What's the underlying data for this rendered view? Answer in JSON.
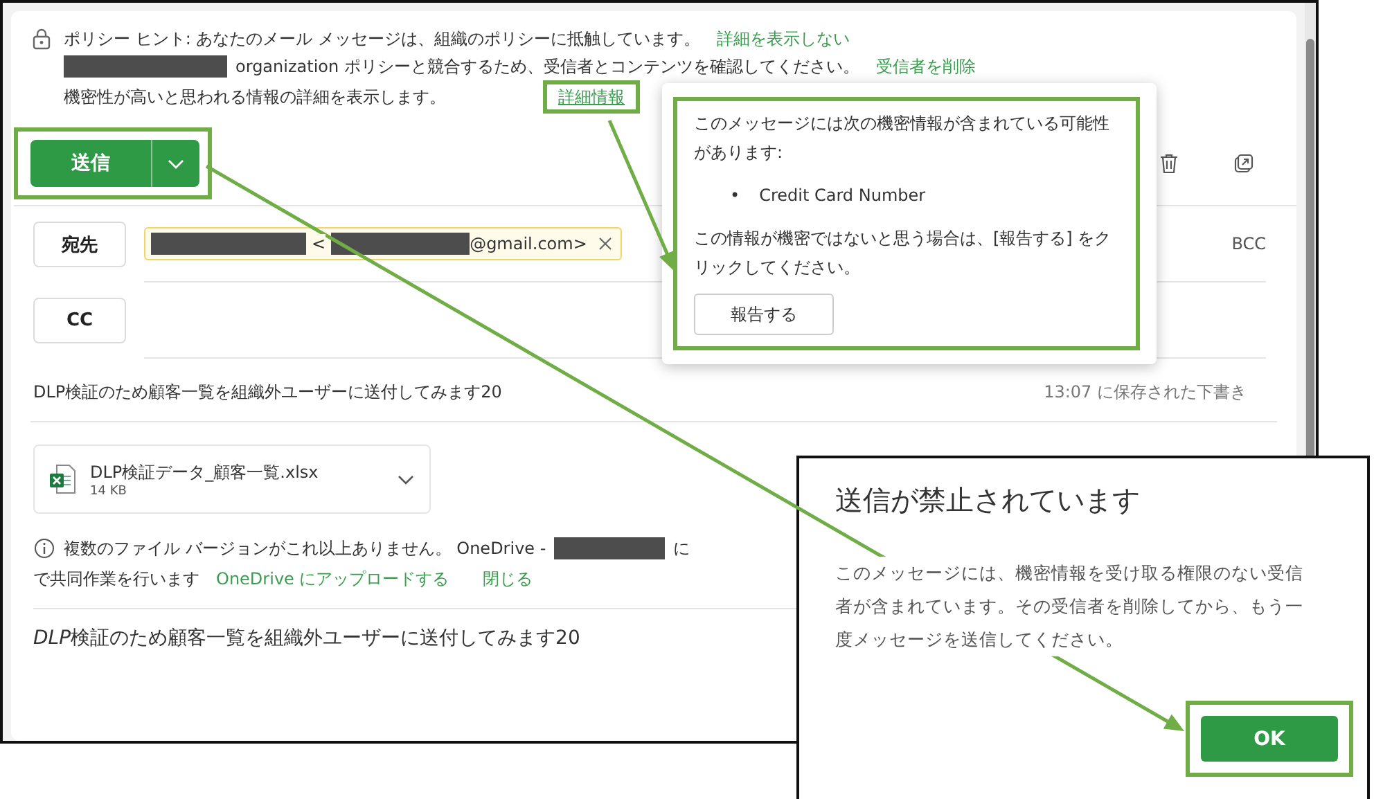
{
  "policy_hint": {
    "line_1": "ポリシー ヒント: あなたのメール メッセージは、組織のポリシーに抵触しています。",
    "hide_details_link": "詳細を表示しない",
    "line_2": "organization ポリシーと競合するため、受信者とコンテンツを確認してください。",
    "remove_recipients_link": "受信者を削除",
    "line_3": "機密性が高いと思われる情報の詳細を表示します。",
    "more_info_link": "詳細情報"
  },
  "toolbar": {
    "send_button": "送信"
  },
  "recipients": {
    "to_button": "宛先",
    "to_chip": {
      "open_bracket": "<",
      "address_end": "@gmail.com>"
    },
    "bcc_link": "BCC",
    "cc_button": "CC"
  },
  "subject": "DLP検証のため顧客一覧を組織外ユーザーに送付してみます20",
  "draft_status": "13:07 に保存された下書き",
  "attachment": {
    "name": "DLP検証データ_顧客一覧.xlsx",
    "size": "14 KB"
  },
  "onedrive_notice": {
    "text": "複数のファイル バージョンがこれ以上ありません。 OneDrive -",
    "text_cut": "に",
    "text_2": "で共同作業を行います",
    "upload_link": "OneDrive にアップロードする",
    "close_link": "閉じる"
  },
  "body": {
    "italic_part": "DLP",
    "text": "検証のため顧客一覧を組織外ユーザーに送付してみます20"
  },
  "policy_popup": {
    "intro": "このメッセージには次の機密情報が含まれている可能性があります:",
    "items": [
      {
        "bullet": "•",
        "text": "Credit Card Number"
      }
    ],
    "note": "この情報が機密ではないと思う場合は、[報告する] をクリックしてください。",
    "report_button": "報告する"
  },
  "dialog": {
    "title": "送信が禁止されています",
    "message": "このメッセージには、機密情報を受け取る権限のない受信者が含まれています。その受信者を削除してから、もう一度メッセージを送信してください。",
    "ok_button": "OK"
  }
}
